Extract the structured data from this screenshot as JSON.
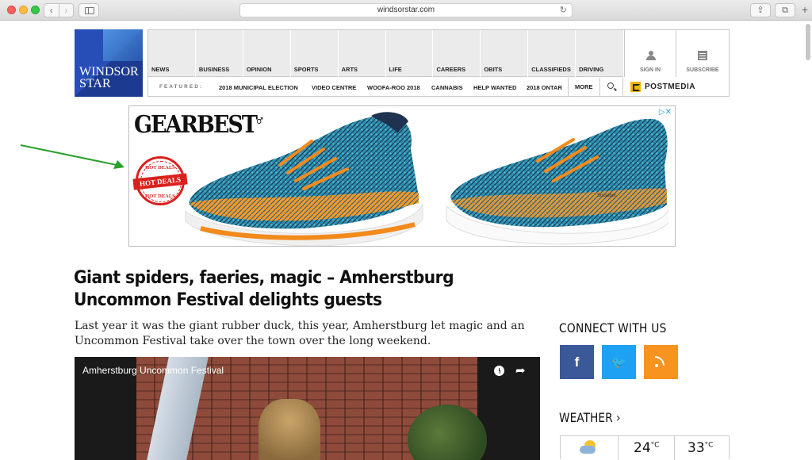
{
  "browser": {
    "url": "windsorstar.com",
    "back_glyph": "‹",
    "forward_glyph": "›",
    "reload_glyph": "↻",
    "share_glyph": "⇪",
    "tabs_glyph": "⧉",
    "newtab_glyph": "+"
  },
  "header": {
    "logo_text_1": "WINDSOR",
    "logo_text_2": "STAR",
    "nav": [
      "NEWS",
      "BUSINESS",
      "OPINION",
      "SPORTS",
      "ARTS",
      "LIFE",
      "CAREERS",
      "OBITS",
      "CLASSIFIEDS",
      "DRIVING"
    ],
    "sign_in": "SIGN IN",
    "subscribe": "SUBSCRIBE",
    "featured_label": "FEATURED:",
    "featured": [
      "2018 MUNICIPAL ELECTION",
      "VIDEO CENTRE",
      "WOOFA-ROO 2018",
      "CANNABIS",
      "HELP WANTED",
      "2018 ONTAR"
    ],
    "more": "MORE",
    "postmedia": "POSTMEDIA"
  },
  "ad": {
    "brand": "GEARBEST",
    "brand_mark": "♂",
    "adchoices": "▷✕",
    "stamp_top": "HOT DEALS",
    "stamp_mid": "HOT DEALS",
    "stamp_bottom": "HOT DEALS",
    "shoe_brand": "Souaiber"
  },
  "article": {
    "headline": "Giant spiders, faeries, magic – Amherstburg Uncommon Festival delights guests",
    "deck": "Last year it was the giant rubber duck, this year, Amherstburg let magic and an Uncommon Festival take over the town over the long weekend.",
    "video_title": "Amherstburg Uncommon Festival",
    "share_glyph": "➦"
  },
  "sidebar": {
    "connect_title": "CONNECT WITH US",
    "facebook": "f",
    "twitter": "🐦",
    "weather_title": "WEATHER ›",
    "temp_high": "24",
    "temp_low": "33",
    "unit": "°C"
  },
  "colors": {
    "logo_blue": "#1c3a8f",
    "facebook": "#3b5998",
    "twitter": "#1da1f2",
    "rss": "#f7931e",
    "annotation_arrow": "#2aa02a"
  }
}
